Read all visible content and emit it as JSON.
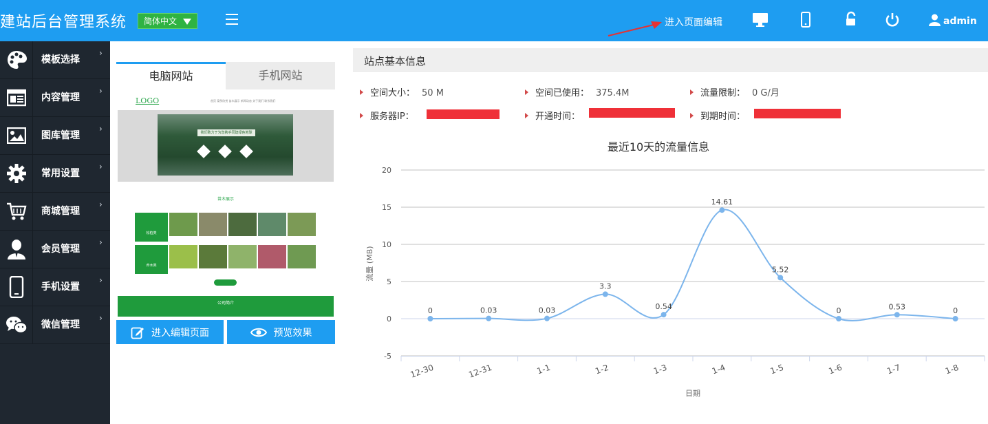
{
  "header": {
    "brand": "建站后台管理系统",
    "language": "简体中文",
    "edit_link": "进入页面编辑",
    "user": "admin",
    "icons": [
      "desktop-icon",
      "mobile-icon",
      "unlock-icon",
      "power-icon",
      "user-icon"
    ]
  },
  "sidebar": {
    "items": [
      {
        "label": "模板选择",
        "icon": "palette-icon"
      },
      {
        "label": "内容管理",
        "icon": "document-icon"
      },
      {
        "label": "图库管理",
        "icon": "image-icon"
      },
      {
        "label": "常用设置",
        "icon": "gear-icon"
      },
      {
        "label": "商城管理",
        "icon": "cart-icon"
      },
      {
        "label": "会员管理",
        "icon": "user-icon"
      },
      {
        "label": "手机设置",
        "icon": "phone-icon"
      },
      {
        "label": "微信管理",
        "icon": "wechat-icon"
      }
    ],
    "chevron": "›"
  },
  "preview": {
    "tabs": [
      "电脑网站",
      "手机网站"
    ],
    "logo": "LOGO",
    "nav": "首页   案例欣赏   苗木展示   新闻动态   关于我们   联系我们",
    "slogan": "我们致力于为您携手同建绿色地球",
    "section_title": "苗木展示",
    "cat1": "松柏类",
    "cat2": "乔木类",
    "footer_title": "公司简介"
  },
  "buttons": {
    "edit": "进入编辑页面",
    "preview": "预览效果"
  },
  "info": {
    "title": "站点基本信息",
    "space_size_label": "空间大小：",
    "space_size": "50 M",
    "space_used_label": "空间已使用：",
    "space_used": "375.4M",
    "traffic_limit_label": "流量限制：",
    "traffic_limit": "0 G/月",
    "server_ip_label": "服务器IP：",
    "open_time_label": "开通时间：",
    "expire_time_label": "到期时间："
  },
  "chart_data": {
    "type": "line",
    "title": "最近10天的流量信息",
    "xlabel": "日期",
    "ylabel": "流量 (MB)",
    "categories": [
      "12-30",
      "12-31",
      "1-1",
      "1-2",
      "1-3",
      "1-4",
      "1-5",
      "1-6",
      "1-7",
      "1-8"
    ],
    "values": [
      0,
      0.03,
      0.03,
      3.3,
      0.54,
      14.61,
      5.52,
      0,
      0.53,
      0
    ],
    "data_labels": [
      "0",
      "0.03",
      "0.03",
      "3.3",
      "0.54",
      "14.61",
      "5.52",
      "0",
      "0.53",
      "0"
    ],
    "ylim": [
      -5,
      20
    ],
    "yticks": [
      -5,
      0,
      5,
      10,
      15,
      20
    ],
    "grid": true,
    "smooth": true,
    "color": "#7cb5ec"
  },
  "colors": {
    "topbar": "#1e9df1",
    "sidebar": "#1f2730",
    "accent": "#1e9df1",
    "redact": "#ef3038"
  }
}
